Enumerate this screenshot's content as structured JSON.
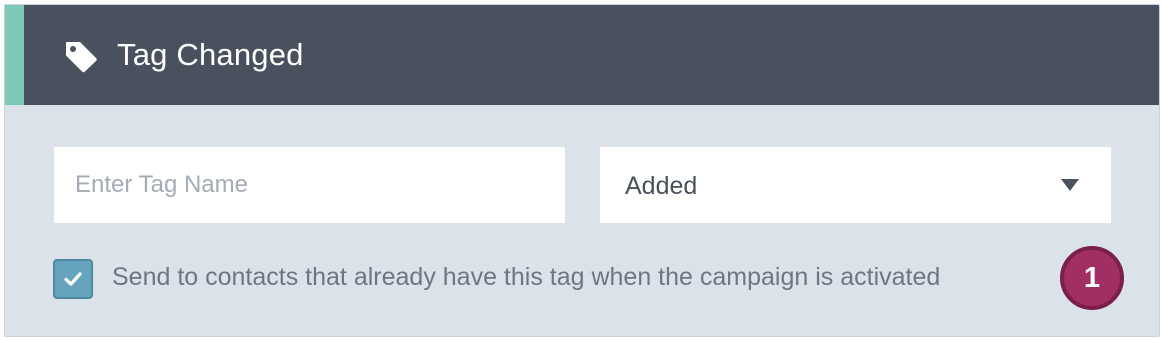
{
  "panel": {
    "title": "Tag Changed",
    "icon": "tag-icon",
    "header_color": "#49515e",
    "accent_color": "#7dc9b7",
    "background_color": "#dbe2e9"
  },
  "form": {
    "tag_name": {
      "placeholder": "Enter Tag Name",
      "value": ""
    },
    "change_type": {
      "selected": "Added"
    },
    "existing_contacts": {
      "checked": true,
      "label": "Send to contacts that already have this tag when the campaign is activated",
      "color": "#64a4be"
    }
  },
  "annotation": {
    "step_number": "1",
    "color": "#a12f64"
  }
}
